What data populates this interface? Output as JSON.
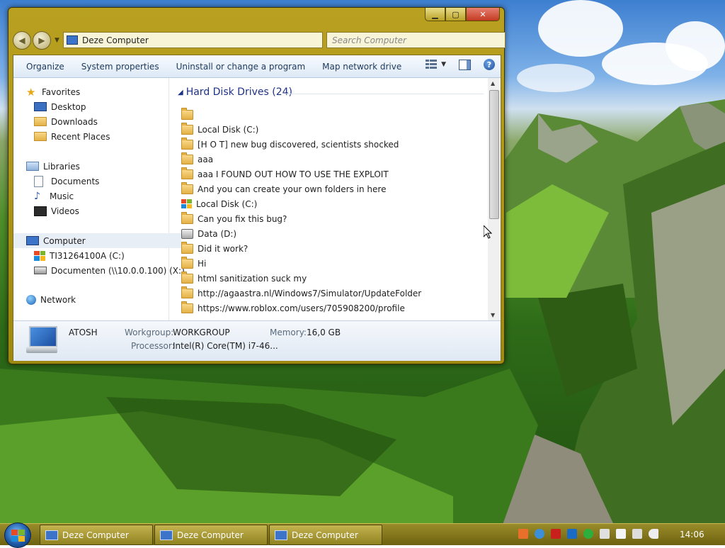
{
  "window": {
    "address": "Deze Computer",
    "search_placeholder": "Search Computer",
    "caption": {
      "minimize": "▁",
      "maximize": "▢",
      "close": "✕"
    }
  },
  "toolbar": {
    "items": [
      "Organize",
      "System properties",
      "Uninstall or change a program",
      "Map network drive"
    ],
    "help": "?"
  },
  "nav": {
    "favorites": {
      "label": "Favorites",
      "items": [
        "Desktop",
        "Downloads",
        "Recent Places"
      ]
    },
    "libraries": {
      "label": "Libraries",
      "items": [
        "Documents",
        "Music",
        "Videos"
      ]
    },
    "computer": {
      "label": "Computer",
      "items": [
        "TI31264100A (C:)",
        "Documenten (\\\\10.0.0.100) (X:)"
      ]
    },
    "network": {
      "label": "Network"
    }
  },
  "group": {
    "title": "Hard Disk Drives (24)"
  },
  "files": [
    {
      "name": "",
      "icon": "folder"
    },
    {
      "name": "Local Disk (C:)",
      "icon": "folder"
    },
    {
      "name": "[H O T] new bug discovered, scientists shocked",
      "icon": "folder"
    },
    {
      "name": "aaa",
      "icon": "folder"
    },
    {
      "name": "aaa I FOUND OUT HOW TO USE THE EXPLOIT",
      "icon": "folder"
    },
    {
      "name": "And you can create your own folders in here",
      "icon": "folder"
    },
    {
      "name": "Local Disk (C:)",
      "icon": "windows-drive"
    },
    {
      "name": "Can you fix this bug?",
      "icon": "folder"
    },
    {
      "name": "Data (D:)",
      "icon": "disk"
    },
    {
      "name": "Did it work?",
      "icon": "folder"
    },
    {
      "name": "Hi",
      "icon": "folder"
    },
    {
      "name": "html sanitization suck my",
      "icon": "folder"
    },
    {
      "name": "http://agaastra.nl/Windows7/Simulator/UpdateFolder",
      "icon": "folder"
    },
    {
      "name": "https://www.roblox.com/users/705908200/profile",
      "icon": "folder"
    }
  ],
  "details": {
    "name": "ATOSH",
    "workgroup_label": "Workgroup:",
    "workgroup": "WORKGROUP",
    "memory_label": "Memory:",
    "memory": "16,0 GB",
    "processor_label": "Processor:",
    "processor": "Intel(R) Core(TM) i7-46..."
  },
  "taskbar": {
    "buttons": [
      "Deze Computer",
      "Deze Computer",
      "Deze Computer"
    ],
    "clock": "14:06"
  },
  "colors": {
    "window_frame": "#b9a020",
    "taskbar": "#8a7c1e",
    "link_blue": "#1e3287"
  }
}
